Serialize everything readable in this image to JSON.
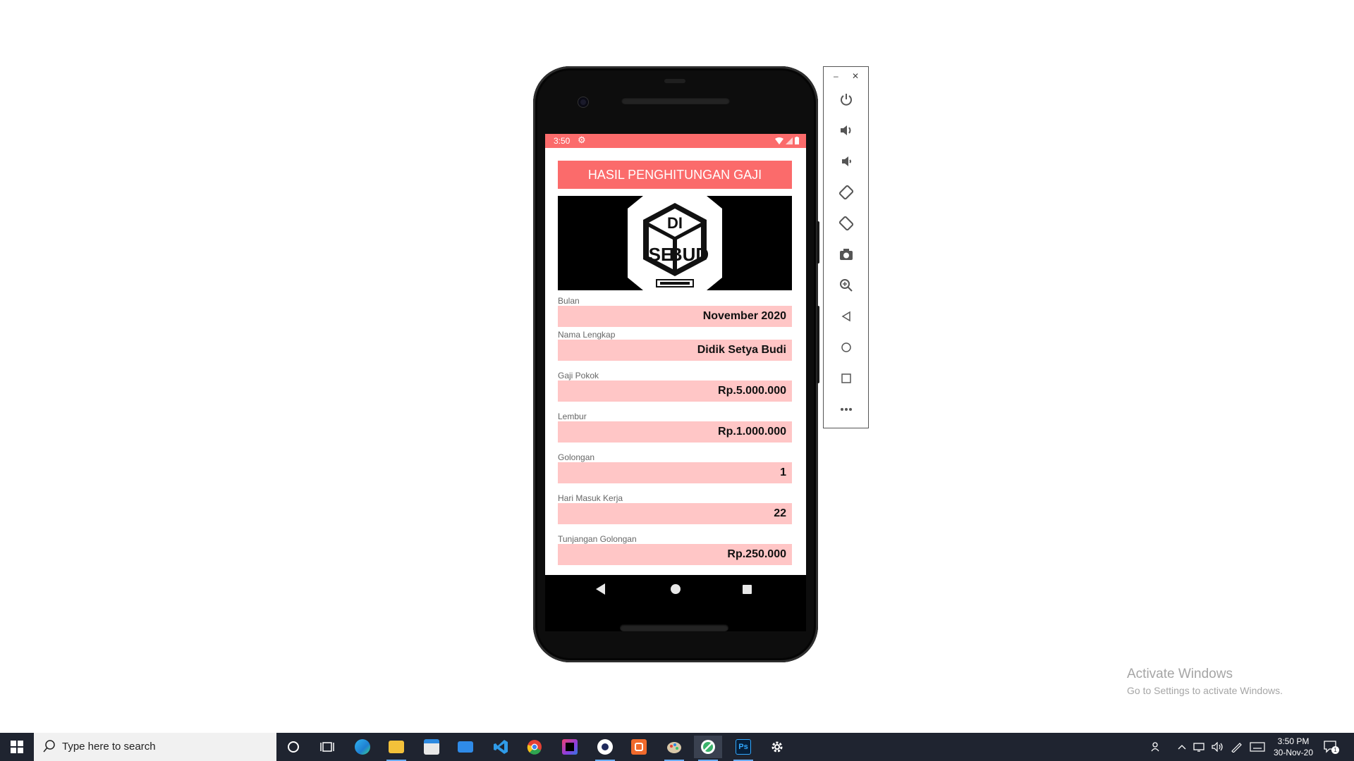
{
  "app": {
    "status_time": "3:50",
    "header_title": "HASIL PENGHITUNGAN GAJI",
    "fields": [
      {
        "label": "Bulan",
        "value": "November 2020"
      },
      {
        "label": "Nama Lengkap",
        "value": "Didik Setya Budi"
      },
      {
        "label": "Gaji Pokok",
        "value": "Rp.5.000.000"
      },
      {
        "label": "Lembur",
        "value": "Rp.1.000.000"
      },
      {
        "label": "Golongan",
        "value": "1"
      },
      {
        "label": "Hari Masuk Kerja",
        "value": "22"
      },
      {
        "label": "Tunjangan Golongan",
        "value": "Rp.250.000"
      }
    ],
    "logo_text": "DISEBUD",
    "colors": {
      "accent": "#fb6b6b",
      "field_bg": "#ffc6c6"
    }
  },
  "emulator_toolbar": {
    "window_controls": [
      "minimize-icon",
      "close-icon"
    ],
    "buttons": [
      "power-icon",
      "volume-up-icon",
      "volume-down-icon",
      "rotate-left-icon",
      "rotate-right-icon",
      "camera-icon",
      "zoom-icon",
      "back-icon",
      "home-icon",
      "overview-icon",
      "more-icon"
    ]
  },
  "watermark": {
    "title": "Activate Windows",
    "subtitle": "Go to Settings to activate Windows."
  },
  "taskbar": {
    "search_placeholder": "Type here to search",
    "pinned": [
      "cortana-icon",
      "task-view-icon",
      "edge-icon",
      "file-explorer-icon",
      "store-icon",
      "mail-icon",
      "vscode-icon",
      "chrome-icon",
      "intellij-icon",
      "word-icon",
      "sublime-icon",
      "paint-icon",
      "android-studio-icon",
      "photoshop-icon",
      "settings-icon"
    ],
    "clock_time": "3:50 PM",
    "clock_date": "30-Nov-20",
    "notification_count": "1"
  }
}
